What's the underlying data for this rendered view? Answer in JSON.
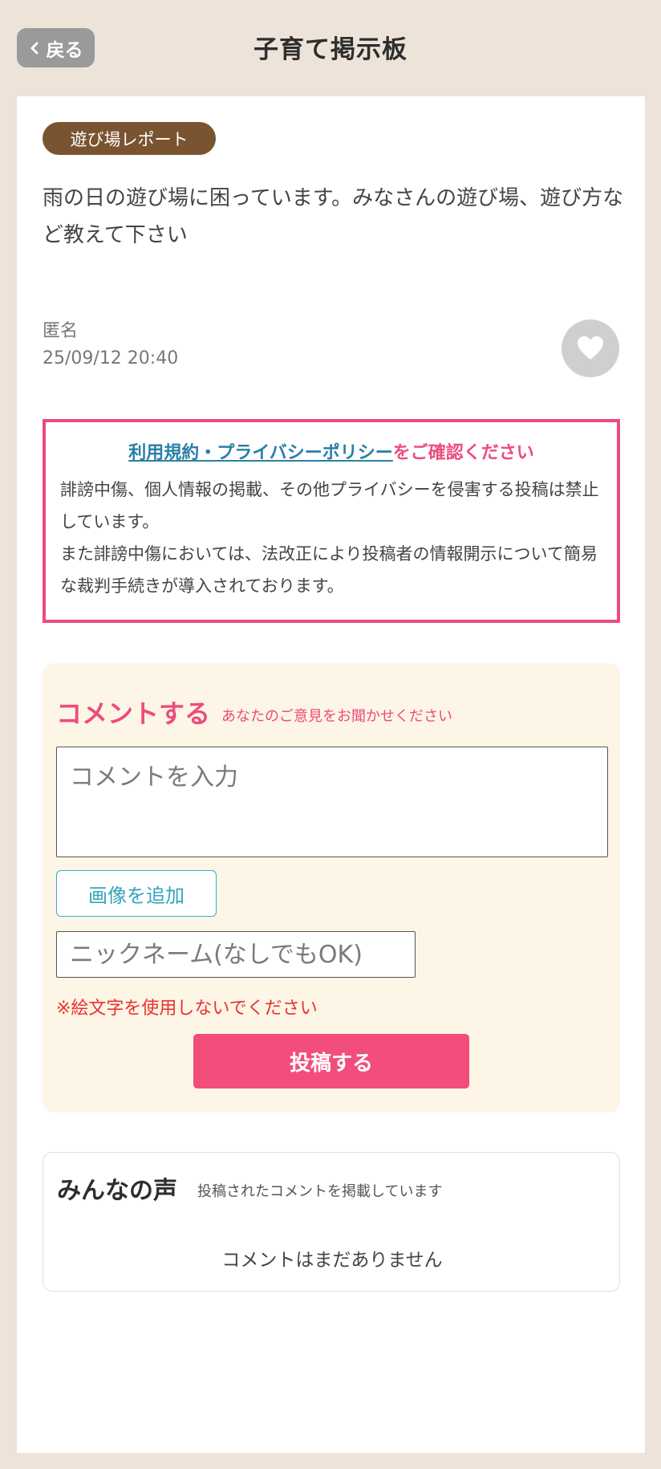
{
  "header": {
    "back_label": "戻る",
    "title": "子育て掲示板"
  },
  "post": {
    "tag": "遊び場レポート",
    "body": "雨の日の遊び場に困っています。みなさんの遊び場、遊び方など教えて下さい",
    "author": "匿名",
    "date": "25/09/12 20:40"
  },
  "notice": {
    "link_text": "利用規約・プライバシーポリシー",
    "head_suffix": "をご確認ください",
    "text": "誹謗中傷、個人情報の掲載、その他プライバシーを侵害する投稿は禁止しています。\nまた誹謗中傷においては、法改正により投稿者の情報開示について簡易な裁判手続きが導入されております。"
  },
  "comment_form": {
    "title": "コメントする",
    "subtitle": "あなたのご意見をお聞かせください",
    "input_placeholder": "コメントを入力",
    "add_image_label": "画像を追加",
    "nickname_placeholder": "ニックネーム(なしでもOK)",
    "warning": "※絵文字を使用しないでください",
    "submit_label": "投稿する"
  },
  "voices": {
    "title": "みんなの声",
    "subtitle": "投稿されたコメントを掲載しています",
    "empty_text": "コメントはまだありません"
  },
  "colors": {
    "background": "#ede3d9",
    "tag": "#7a5430",
    "accent_pink": "#ee4b7d",
    "submit": "#f24d7b",
    "link": "#2a7fa6",
    "warning": "#e8312f",
    "form_bg": "#fdf6e6"
  },
  "icons": {
    "back": "chevron-left-icon",
    "like": "heart-icon"
  }
}
